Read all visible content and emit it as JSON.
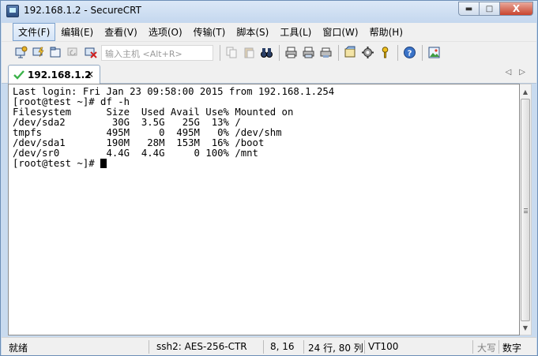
{
  "window": {
    "title": "192.168.1.2 - SecureCRT"
  },
  "window_controls": {
    "minimize": "▬",
    "maximize": "□",
    "close": "X"
  },
  "menu": {
    "items": [
      "文件(F)",
      "编辑(E)",
      "查看(V)",
      "选项(O)",
      "传输(T)",
      "脚本(S)",
      "工具(L)",
      "窗口(W)",
      "帮助(H)"
    ]
  },
  "toolbar": {
    "input_placeholder": "输入主机 <Alt+R>"
  },
  "tab": {
    "label": "192.168.1.2",
    "close": "×",
    "nav_prev": "◁",
    "nav_next": "▷"
  },
  "terminal": {
    "lines": [
      "Last login: Fri Jan 23 09:58:00 2015 from 192.168.1.254",
      "[root@test ~]# df -h",
      "Filesystem      Size  Used Avail Use% Mounted on",
      "/dev/sda2        30G  3.5G   25G  13% /",
      "tmpfs           495M     0  495M   0% /dev/shm",
      "/dev/sda1       190M   28M  153M  16% /boot",
      "/dev/sr0        4.4G  4.4G     0 100% /mnt"
    ],
    "prompt": "[root@test ~]# "
  },
  "status": {
    "ready": "就绪",
    "cipher": "ssh2: AES-256-CTR",
    "cursor_pos": "8, 16",
    "size": "24 行, 80 列",
    "emulation": "VT100",
    "caps": "大写",
    "num": "数字"
  },
  "colors": {
    "tab_check": "#3bb24a",
    "frame": "#c9dbef"
  }
}
